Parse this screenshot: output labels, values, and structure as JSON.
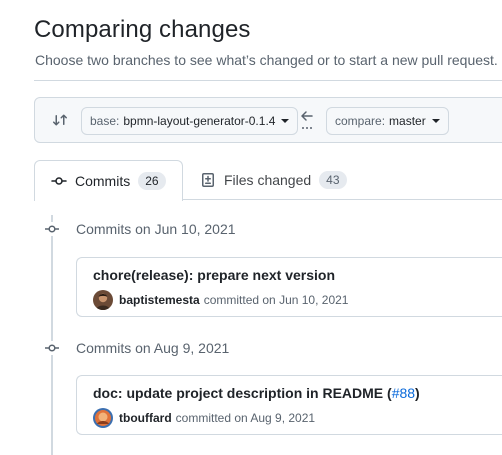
{
  "header": {
    "title": "Comparing changes",
    "subtitle": "Choose two branches to see what’s changed or to start a new pull request."
  },
  "range": {
    "base_label": "base:",
    "base_value": "bpmn-layout-generator-0.1.4",
    "compare_label": "compare:",
    "compare_value": "master"
  },
  "tabs": [
    {
      "label": "Commits",
      "count": "26",
      "active": true,
      "icon": "git-commit-icon"
    },
    {
      "label": "Files changed",
      "count": "43",
      "active": false,
      "icon": "file-diff-icon"
    }
  ],
  "commit_groups": [
    {
      "date_label": "Commits on Jun 10, 2021",
      "commits": [
        {
          "title": "chore(release): prepare next version",
          "pr": "",
          "author": "baptistemesta",
          "meta": "committed on Jun 10, 2021"
        }
      ]
    },
    {
      "date_label": "Commits on Aug 9, 2021",
      "commits": [
        {
          "title": "doc: update project description in README (",
          "pr": "#88",
          "title_end": ")",
          "author": "tbouffard",
          "meta": "committed on Aug 9, 2021"
        }
      ]
    }
  ],
  "colors": {
    "link": "#0969da",
    "muted": "#59636e",
    "border": "#d1d9e0",
    "counter_bg": "#e6eaef"
  }
}
